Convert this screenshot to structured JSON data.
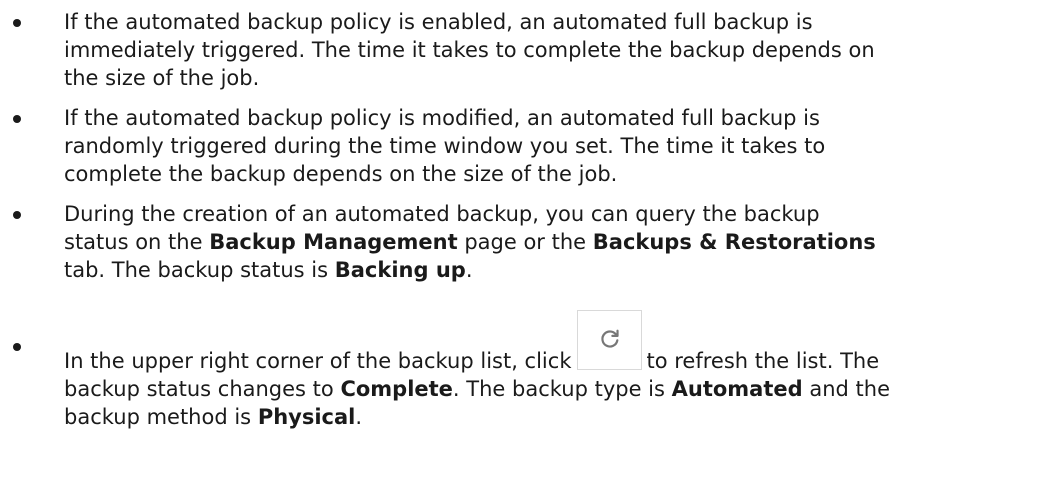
{
  "bullets": [
    {
      "line1": "If the automated backup policy is enabled, an automated full backup is",
      "line2": "immediately triggered. The time it takes to complete the backup depends on",
      "line3": "the size of the job."
    },
    {
      "line1": "If the automated backup policy is modified, an automated full backup is",
      "line2": "randomly triggered during the time window you set. The time it takes to",
      "line3": "complete the backup depends on the size of the job."
    },
    {
      "l1_a": "During the creation of an automated backup, you can query the backup",
      "l2_a": "status on the ",
      "l2_b": "Backup Management",
      "l2_c": " page or the ",
      "l2_d": "Backups & Restorations",
      "l3_a": "tab. The backup status is ",
      "l3_b": "Backing up",
      "l3_c": "."
    },
    {
      "l1_a": "In the upper right corner of the backup list, click",
      "l1_b": "to refresh the list. The",
      "l2_a": "backup status changes to ",
      "l2_b": "Complete",
      "l2_c": ". The backup type is ",
      "l2_d": "Automated",
      "l2_e": " and the",
      "l3_a": "backup method is ",
      "l3_b": "Physical",
      "l3_c": "."
    }
  ],
  "refresh_button": {
    "icon": "refresh-icon"
  }
}
